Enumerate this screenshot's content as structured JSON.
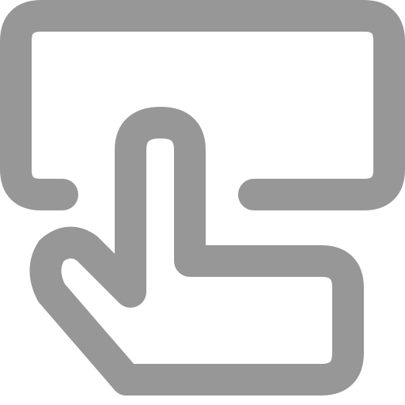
{
  "icon": {
    "name": "touch-screen-tap-icon",
    "stroke_color": "#979797",
    "background_color": "#ffffff"
  }
}
